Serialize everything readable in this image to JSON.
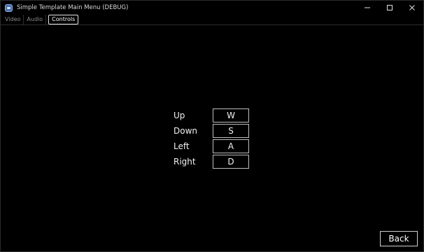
{
  "window": {
    "title": "Simple Template Main Menu (DEBUG)",
    "icon": "app-logo-icon",
    "controls": [
      "minimize-icon",
      "maximize-icon",
      "close-icon"
    ]
  },
  "tabs": [
    {
      "label": "Video",
      "active": false
    },
    {
      "label": "Audio",
      "active": false
    },
    {
      "label": "Controls",
      "active": true
    }
  ],
  "controls": [
    {
      "action": "Up",
      "key": "W"
    },
    {
      "action": "Down",
      "key": "S"
    },
    {
      "action": "Left",
      "key": "A"
    },
    {
      "action": "Right",
      "key": "D"
    }
  ],
  "back_button": {
    "label": "Back"
  },
  "colors": {
    "background": "#000000",
    "text": "#f2f2f2",
    "border": "#bdbdbd"
  }
}
